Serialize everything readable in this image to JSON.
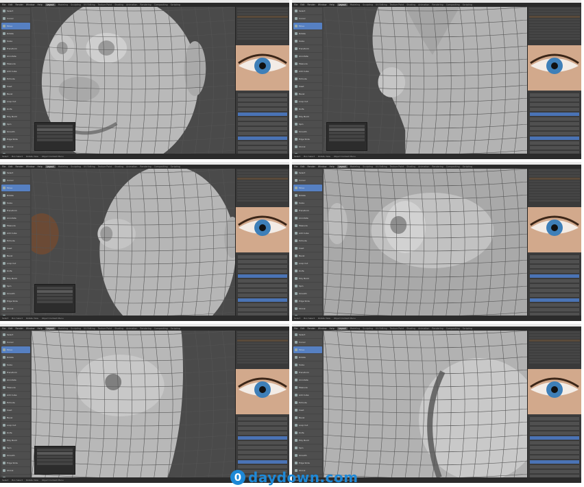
{
  "app": {
    "title_bar_text": "",
    "menu": [
      "File",
      "Edit",
      "Render",
      "Window",
      "Help"
    ],
    "workspaces": [
      "Layout",
      "Modeling",
      "Sculpting",
      "UV Editing",
      "Texture Paint",
      "Shading",
      "Animation",
      "Rendering",
      "Compositing",
      "Scripting"
    ],
    "active_workspace": "Layout"
  },
  "tools": [
    "Select",
    "Cursor",
    "Move",
    "Rotate",
    "Scale",
    "Transform",
    "Annotate",
    "Measure",
    "Add Cube",
    "Extrude",
    "Inset",
    "Bevel",
    "Loop Cut",
    "Knife",
    "Poly Build",
    "Spin",
    "Smooth",
    "Edge Slide",
    "Shrink",
    "Shear",
    "Rip Region"
  ],
  "panels": [
    {
      "id": "p1",
      "subject": "face-front",
      "operator": true
    },
    {
      "id": "p2",
      "subject": "nose-side",
      "operator": true
    },
    {
      "id": "p3",
      "subject": "head-three-quarter",
      "operator": true
    },
    {
      "id": "p4",
      "subject": "eye-closeup",
      "operator": false
    },
    {
      "id": "p5",
      "subject": "eye-socket",
      "operator": true
    },
    {
      "id": "p6",
      "subject": "eyeball-sphere",
      "operator": false
    }
  ],
  "status": [
    "Select",
    "Box Select",
    "Rotate View",
    "Object Context Menu"
  ],
  "watermark": {
    "mark": "0",
    "text": "daydown.com"
  },
  "colors": {
    "accent": "#5680c2",
    "watermark": "#1e88d6",
    "viewport": "#4a4a4a"
  }
}
